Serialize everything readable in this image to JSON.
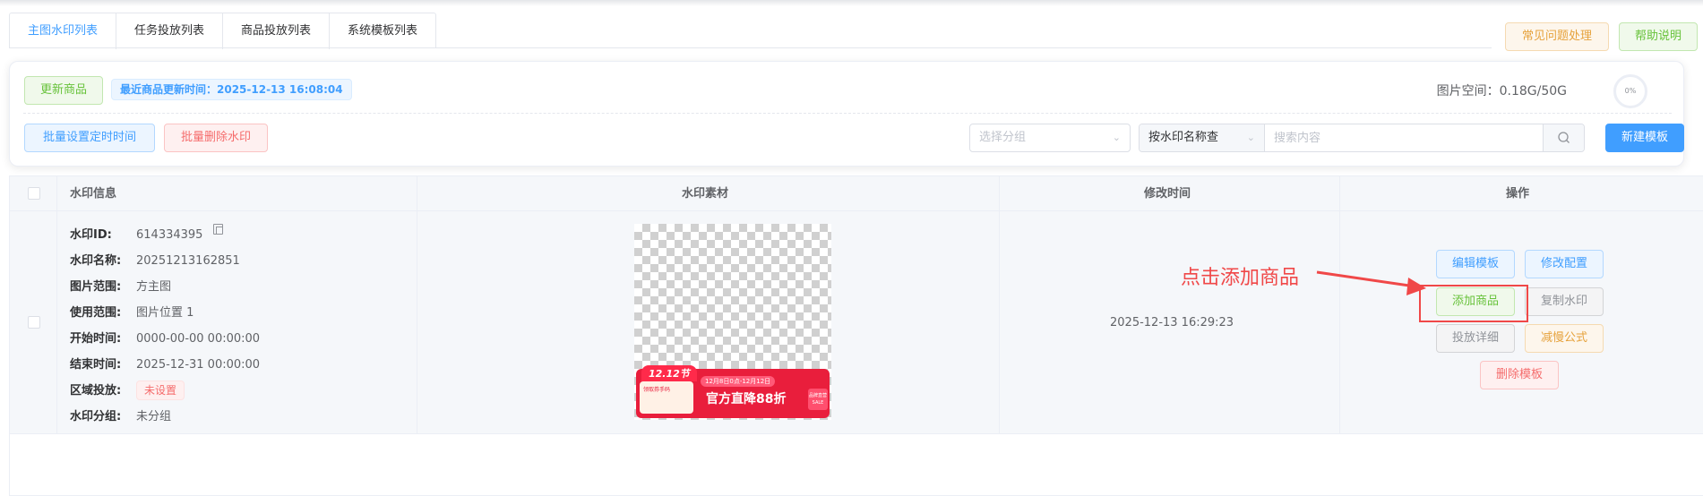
{
  "tabs": [
    {
      "label": "主图水印列表",
      "active": true
    },
    {
      "label": "任务投放列表",
      "active": false
    },
    {
      "label": "商品投放列表",
      "active": false
    },
    {
      "label": "系统模板列表",
      "active": false
    }
  ],
  "header_buttons": {
    "faq": "常见问题处理",
    "help": "帮助说明"
  },
  "toolbar": {
    "update_goods": "更新商品",
    "last_update": "最近商品更新时间：2025-12-13 16:08:04",
    "space_label": "图片空间：0.18G/50G",
    "space_percent": "0%",
    "batch_schedule": "批量设置定时时间",
    "batch_delete": "批量删除水印",
    "group_placeholder": "选择分组",
    "search_by": "按水印名称查",
    "search_placeholder": "搜索内容",
    "new_template": "新建模板"
  },
  "table": {
    "columns": [
      "水印信息",
      "水印素材",
      "修改时间",
      "操作"
    ],
    "rows": [
      {
        "fields": [
          {
            "k": "水印ID:",
            "v": "614334395"
          },
          {
            "k": "水印名称:",
            "v": "20251213162851"
          },
          {
            "k": "图片范围:",
            "v": "方主图"
          },
          {
            "k": "使用范围:",
            "v": "图片位置 1"
          },
          {
            "k": "开始时间:",
            "v": "0000-00-00 00:00:00"
          },
          {
            "k": "结束时间:",
            "v": "2025-12-31 00:00:00"
          },
          {
            "k": "区域投放:",
            "v": "未设置"
          },
          {
            "k": "水印分组:",
            "v": "未分组"
          }
        ],
        "banner": {
          "badge": "12.12节",
          "left_text": "领取券手码",
          "pill": "12月8日0点-12月12日",
          "big": "官方直降88折",
          "right": "品牌直营 SALE"
        },
        "modified": "2025-12-13 16:29:23",
        "actions": {
          "edit": "编辑模板",
          "config": "修改配置",
          "add_goods": "添加商品",
          "copy": "复制水印",
          "detail": "投放详细",
          "formula": "减慢公式",
          "delete": "删除模板"
        }
      }
    ]
  },
  "annotation": {
    "text": "点击添加商品",
    "color": "#f04848"
  },
  "colors": {
    "primary": "#409eff",
    "success": "#67c23a",
    "warning": "#e6a23c",
    "danger": "#f56c6c"
  }
}
